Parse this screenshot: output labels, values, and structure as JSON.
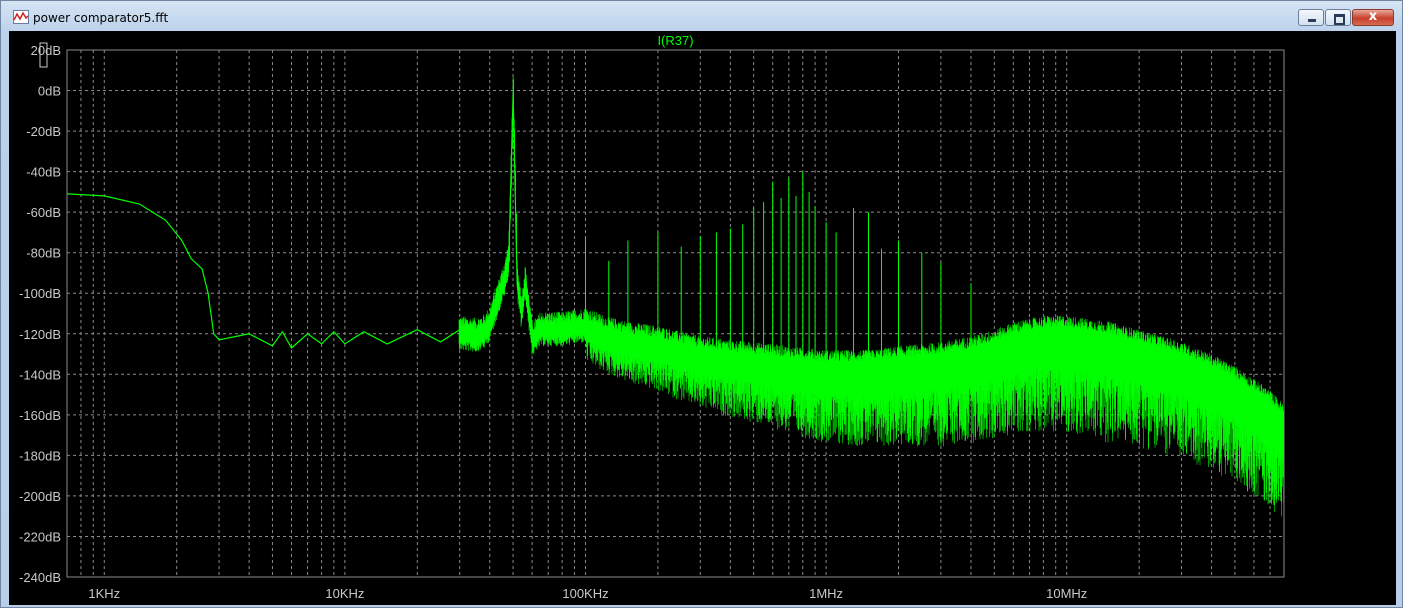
{
  "window": {
    "title": "power comparator5.fft",
    "minimize_label": "",
    "maximize_label": "",
    "close_label": "x"
  },
  "colors": {
    "trace": "#00ff00",
    "background": "#000000",
    "grid": "#8a8a8a",
    "tick_text": "#c8c8c8"
  },
  "chart_data": {
    "type": "line",
    "title": "I(R37)",
    "xlabel": "",
    "ylabel": "",
    "x_scale": "log",
    "xlim": [
      700,
      80000000
    ],
    "ylim": [
      -240,
      20
    ],
    "grid": true,
    "x_ticks": [
      {
        "value": 1000,
        "label": "1KHz"
      },
      {
        "value": 10000,
        "label": "10KHz"
      },
      {
        "value": 100000,
        "label": "100KHz"
      },
      {
        "value": 1000000,
        "label": "1MHz"
      },
      {
        "value": 10000000,
        "label": "10MHz"
      }
    ],
    "y_ticks": [
      {
        "value": 20,
        "label": "20dB"
      },
      {
        "value": 0,
        "label": "0dB"
      },
      {
        "value": -20,
        "label": "-20dB"
      },
      {
        "value": -40,
        "label": "-40dB"
      },
      {
        "value": -60,
        "label": "-60dB"
      },
      {
        "value": -80,
        "label": "-80dB"
      },
      {
        "value": -100,
        "label": "-100dB"
      },
      {
        "value": -120,
        "label": "-120dB"
      },
      {
        "value": -140,
        "label": "-140dB"
      },
      {
        "value": -160,
        "label": "-160dB"
      },
      {
        "value": -180,
        "label": "-180dB"
      },
      {
        "value": -200,
        "label": "-200dB"
      },
      {
        "value": -220,
        "label": "-220dB"
      },
      {
        "value": -240,
        "label": "-240dB"
      }
    ],
    "series": [
      {
        "name": "I(R37)",
        "x": [
          700,
          1000,
          1400,
          1800,
          2100,
          2300,
          2550,
          2700,
          2850,
          3000,
          4000,
          5000,
          5500,
          6000,
          7000,
          8000,
          9000,
          10000,
          12000,
          15000,
          20000,
          25000,
          30000,
          35000,
          38000,
          40000,
          43000,
          46000,
          48000,
          50000,
          52000,
          54000,
          56000,
          60000,
          65000,
          70000,
          80000,
          90000,
          100000,
          120000,
          150000,
          200000,
          250000,
          300000,
          400000,
          500000,
          600000,
          700000,
          800000,
          1000000,
          1200000,
          1500000,
          2000000,
          2500000,
          3000000,
          4000000,
          5000000,
          6000000,
          8000000,
          10000000,
          15000000,
          20000000,
          30000000,
          40000000,
          50000000,
          60000000,
          70000000,
          80000000
        ],
        "values": [
          -51,
          -52,
          -56,
          -64,
          -74,
          -83,
          -88,
          -100,
          -120,
          -123,
          -123,
          -123,
          -122,
          -124,
          -123,
          -122,
          -122,
          -122,
          -122,
          -122,
          -121,
          -121,
          -121,
          -122,
          -120,
          -116,
          -104,
          -94,
          -83,
          -2,
          -96,
          -110,
          -96,
          -124,
          -119,
          -119,
          -119,
          -118,
          -117,
          -121,
          -124,
          -126,
          -129,
          -131,
          -133,
          -134,
          -135,
          -136,
          -137,
          -138,
          -138,
          -138,
          -136,
          -135,
          -134,
          -131,
          -128,
          -124,
          -121,
          -121,
          -124,
          -128,
          -134,
          -140,
          -146,
          -152,
          -158,
          -165
        ]
      }
    ],
    "spurs": [
      {
        "x": 100000,
        "value": -72
      },
      {
        "x": 125000,
        "value": -84
      },
      {
        "x": 150000,
        "value": -74
      },
      {
        "x": 200000,
        "value": -70
      },
      {
        "x": 250000,
        "value": -77
      },
      {
        "x": 300000,
        "value": -72
      },
      {
        "x": 350000,
        "value": -70
      },
      {
        "x": 400000,
        "value": -68
      },
      {
        "x": 450000,
        "value": -66
      },
      {
        "x": 500000,
        "value": -58
      },
      {
        "x": 550000,
        "value": -55
      },
      {
        "x": 600000,
        "value": -45
      },
      {
        "x": 650000,
        "value": -53
      },
      {
        "x": 700000,
        "value": -43
      },
      {
        "x": 750000,
        "value": -52
      },
      {
        "x": 800000,
        "value": -40
      },
      {
        "x": 850000,
        "value": -50
      },
      {
        "x": 900000,
        "value": -57
      },
      {
        "x": 1000000,
        "value": -65
      },
      {
        "x": 1100000,
        "value": -70
      },
      {
        "x": 1300000,
        "value": -58
      },
      {
        "x": 1500000,
        "value": -60
      },
      {
        "x": 1700000,
        "value": -78
      },
      {
        "x": 2000000,
        "value": -74
      },
      {
        "x": 2500000,
        "value": -80
      },
      {
        "x": 3000000,
        "value": -85
      },
      {
        "x": 4000000,
        "value": -95
      }
    ]
  }
}
